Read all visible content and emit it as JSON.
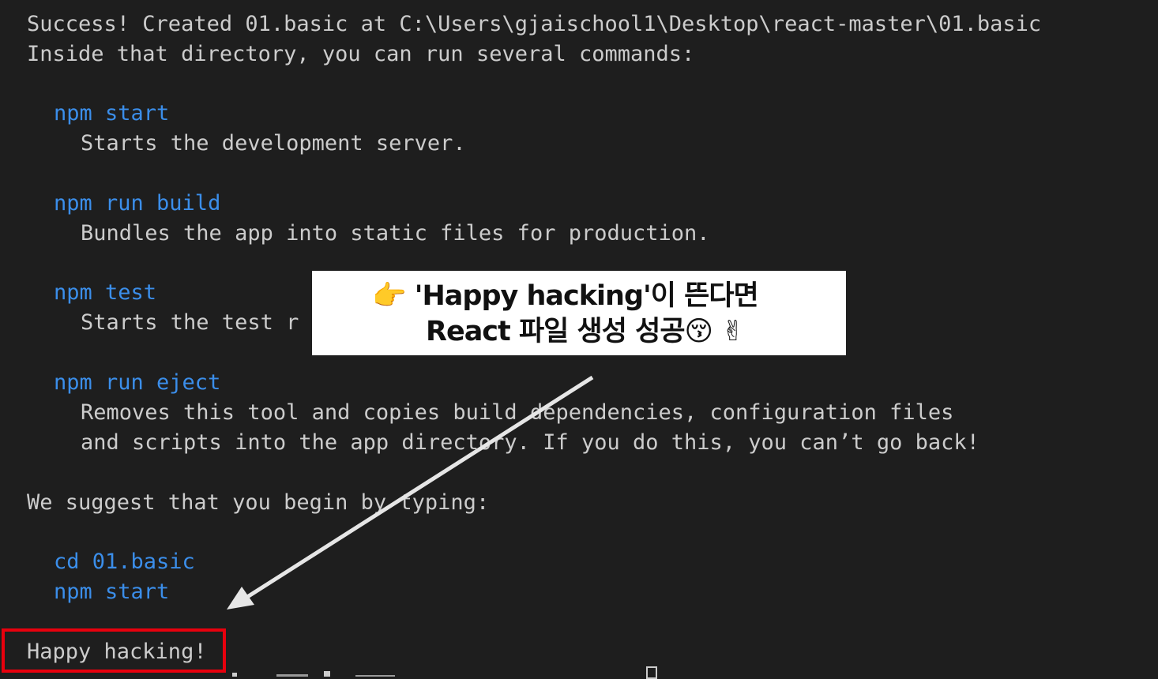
{
  "terminal": {
    "lines": [
      {
        "text": "Success! Created 01.basic at C:\\Users\\gjaischool1\\Desktop\\react-master\\01.basic",
        "kind": "output"
      },
      {
        "text": "Inside that directory, you can run several commands:",
        "kind": "output"
      },
      {
        "text": "npm start",
        "kind": "command"
      },
      {
        "text": "Starts the development server.",
        "kind": "output"
      },
      {
        "text": "npm run build",
        "kind": "command"
      },
      {
        "text": "Bundles the app into static files for production.",
        "kind": "output"
      },
      {
        "text": "npm test",
        "kind": "command"
      },
      {
        "text": "Starts the test r",
        "kind": "output"
      },
      {
        "text": "npm run eject",
        "kind": "command"
      },
      {
        "text": "Removes this tool and copies build dependencies, configuration files",
        "kind": "output"
      },
      {
        "text": "and scripts into the app directory. If you do this, you can’t go back!",
        "kind": "output"
      },
      {
        "text": "We suggest that you begin by typing:",
        "kind": "output"
      },
      {
        "text": "cd 01.basic",
        "kind": "command"
      },
      {
        "text": "npm start",
        "kind": "command"
      },
      {
        "text": "Happy hacking!",
        "kind": "output"
      }
    ]
  },
  "callout": {
    "line1": "👉 'Happy hacking'이 뜬다면",
    "line2": "React 파일 생성 성공😚 ✌"
  },
  "colors": {
    "background": "#1e1e1e",
    "text": "#cccccc",
    "command": "#3b8eea",
    "highlight_border": "#e8000d",
    "callout_background": "#ffffff",
    "arrow": "#e6e6e6"
  }
}
